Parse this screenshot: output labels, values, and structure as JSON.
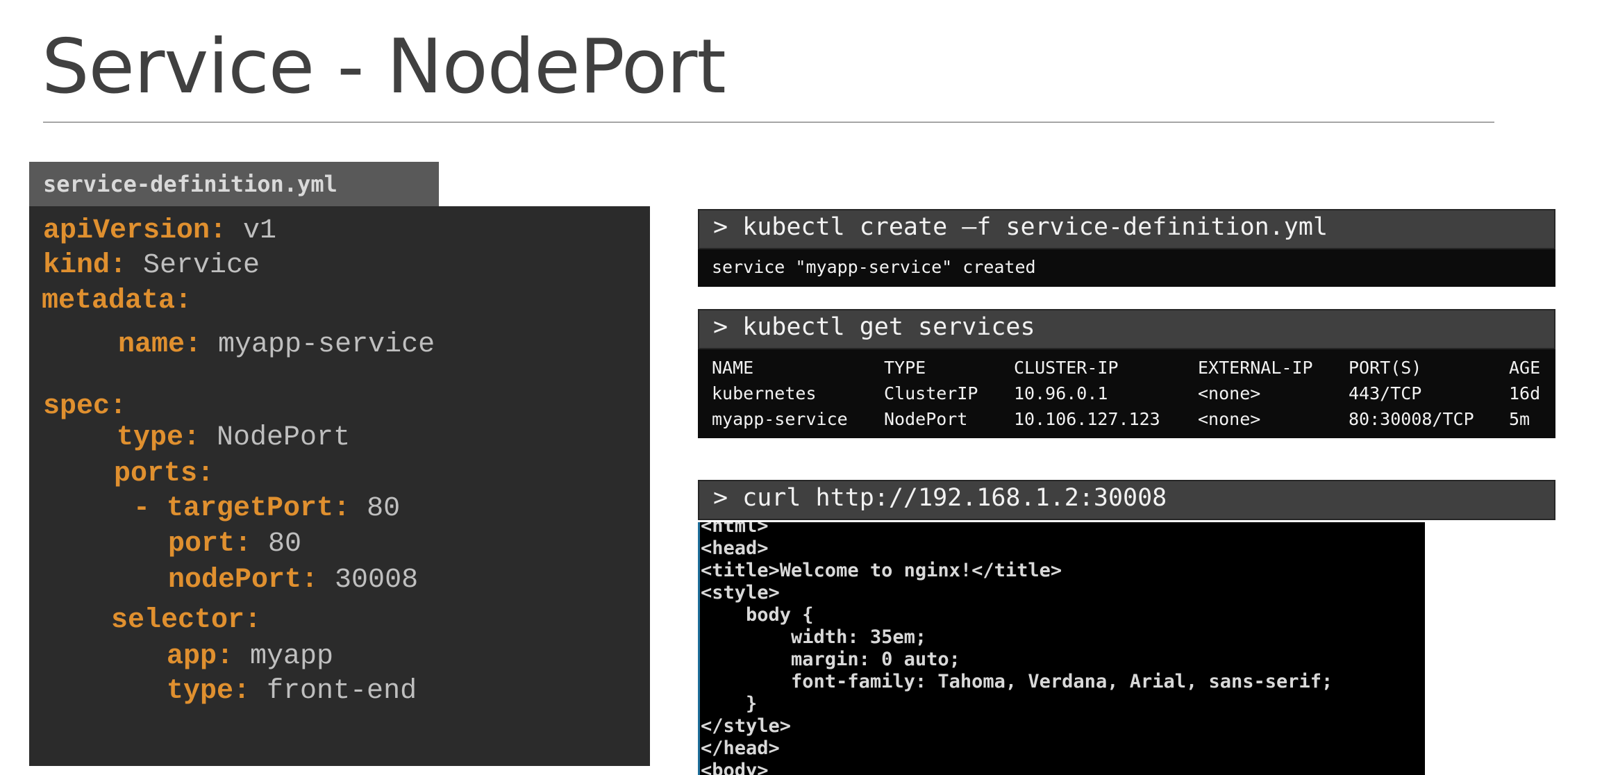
{
  "slide": {
    "title": "Service - NodePort"
  },
  "yaml_file": {
    "filename": "service-definition.yml",
    "lines": [
      {
        "key": "apiVersion:",
        "value": " v1"
      },
      {
        "key": "kind:",
        "value": " Service"
      },
      {
        "key": "metadata:",
        "value": ""
      },
      {
        "key": "name:",
        "value": " myapp-service"
      },
      {
        "key": "spec:",
        "value": ""
      },
      {
        "key": "type:",
        "value": " NodePort"
      },
      {
        "key": "ports:",
        "value": ""
      },
      {
        "key": "- targetPort:",
        "value": " 80"
      },
      {
        "key": "port:",
        "value": " 80"
      },
      {
        "key": "nodePort:",
        "value": " 30008"
      },
      {
        "key": "selector:",
        "value": ""
      },
      {
        "key": "app:",
        "value": " myapp"
      },
      {
        "key": "type:",
        "value": " front-end"
      }
    ],
    "colors": {
      "key": "#e0902f",
      "value": "#bfbfbf",
      "background": "#2b2b2b"
    }
  },
  "terminal_create": {
    "command": "> kubectl create –f service-definition.yml",
    "output": "service \"myapp-service\" created"
  },
  "terminal_get": {
    "command": "> kubectl get services",
    "headers": [
      "NAME",
      "TYPE",
      "CLUSTER-IP",
      "EXTERNAL-IP",
      "PORT(S)",
      "AGE"
    ],
    "rows": [
      [
        "kubernetes",
        "ClusterIP",
        "10.96.0.1",
        "<none>",
        "443/TCP",
        "16d"
      ],
      [
        "myapp-service",
        "NodePort",
        "10.106.127.123",
        "<none>",
        "80:30008/TCP",
        "5m"
      ]
    ]
  },
  "terminal_curl": {
    "command": "> curl http://192.168.1.2:30008",
    "output_lines": [
      "<html>",
      "<head>",
      "<title>Welcome to nginx!</title>",
      "<style>",
      "    body {",
      "        width: 35em;",
      "        margin: 0 auto;",
      "        font-family: Tahoma, Verdana, Arial, sans-serif;",
      "    }",
      "</style>",
      "</head>",
      "<body>"
    ]
  }
}
